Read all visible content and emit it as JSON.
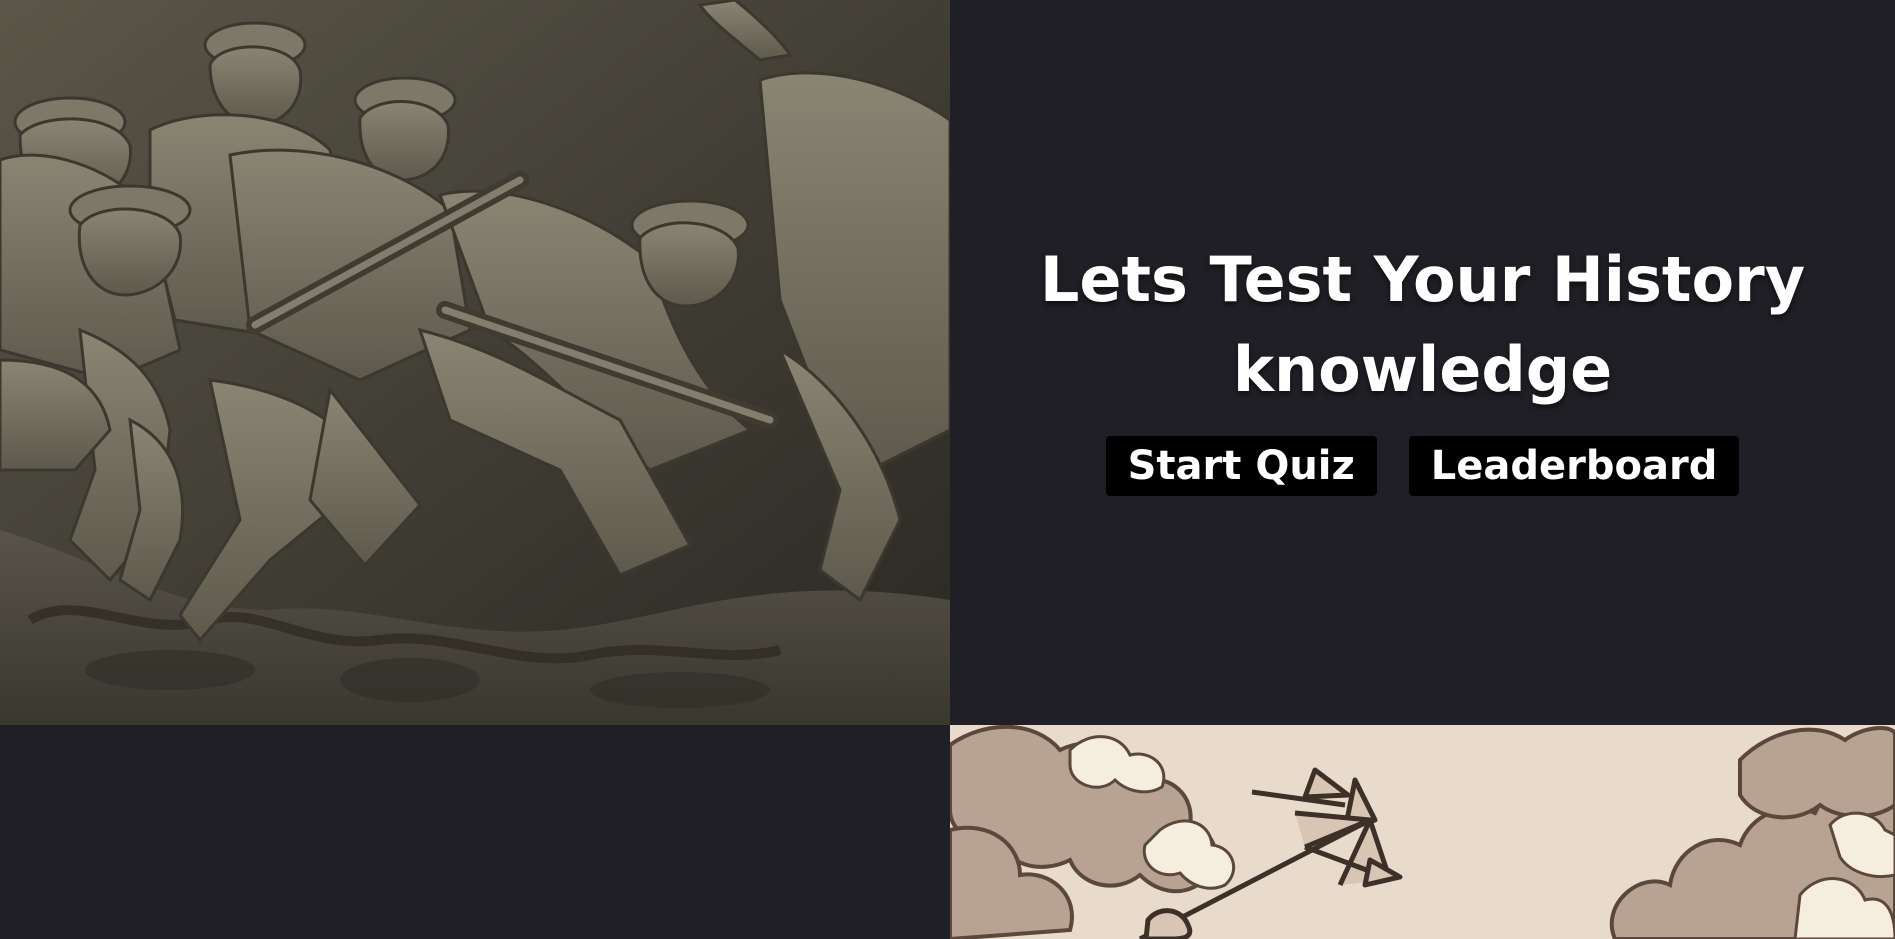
{
  "hero": {
    "title": "Lets Test Your History knowledge",
    "image_subject": "soldier-relief-sculpture"
  },
  "actions": {
    "start_label": "Start Quiz",
    "leaderboard_label": "Leaderboard"
  },
  "decorative_art": {
    "subject": "trident-and-clouds-illustration"
  },
  "colors": {
    "background": "#201f25",
    "button_background": "#000000",
    "button_text": "#ffffff",
    "art_background": "#e9dbcb",
    "sculpture_tone": "#6a6658"
  }
}
